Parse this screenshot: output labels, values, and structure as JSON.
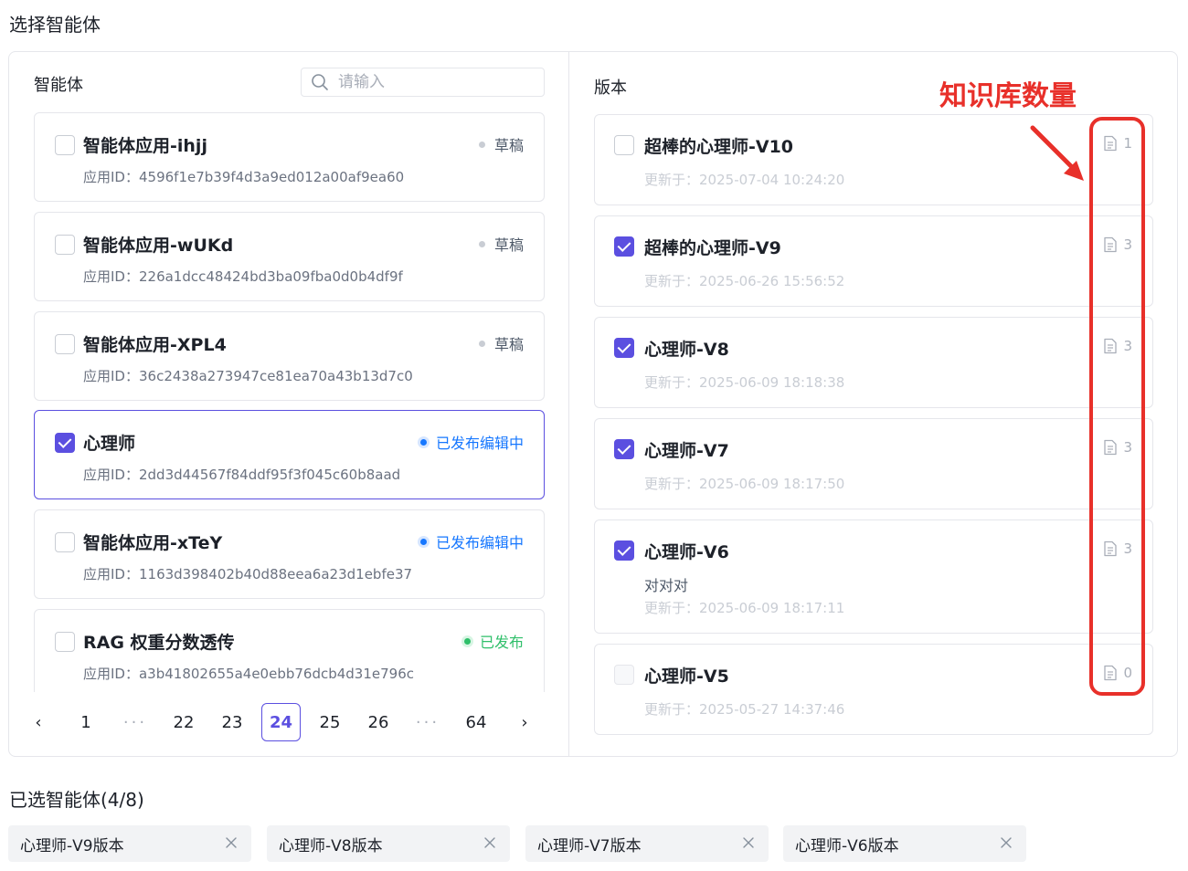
{
  "page_title": "选择智能体",
  "agents_panel": {
    "label": "智能体",
    "search_placeholder": "请输入",
    "agents": [
      {
        "name": "智能体应用-ihjj",
        "id_label": "应用ID：",
        "id": "4596f1e7b39f4d3a9ed012a00af9ea60",
        "status": "草稿",
        "status_type": "draft",
        "checked": false
      },
      {
        "name": "智能体应用-wUKd",
        "id_label": "应用ID：",
        "id": "226a1dcc48424bd3ba09fba0d0b4df9f",
        "status": "草稿",
        "status_type": "draft",
        "checked": false
      },
      {
        "name": "智能体应用-XPL4",
        "id_label": "应用ID：",
        "id": "36c2438a273947ce81ea70a43b13d7c0",
        "status": "草稿",
        "status_type": "draft",
        "checked": false
      },
      {
        "name": "心理师",
        "id_label": "应用ID：",
        "id": "2dd3d44567f84ddf95f3f045c60b8aad",
        "status": "已发布编辑中",
        "status_type": "editing",
        "checked": true
      },
      {
        "name": "智能体应用-xTeY",
        "id_label": "应用ID：",
        "id": "1163d398402b40d88eea6a23d1ebfe37",
        "status": "已发布编辑中",
        "status_type": "editing",
        "checked": false
      },
      {
        "name": "RAG 权重分数透传",
        "id_label": "应用ID：",
        "id": "a3b41802655a4e0ebb76dcb4d31e796c",
        "status": "已发布",
        "status_type": "published",
        "checked": false
      }
    ],
    "pagination": {
      "prev": "‹",
      "next": "›",
      "items": [
        "1",
        "···",
        "22",
        "23",
        "24",
        "25",
        "26",
        "···",
        "64"
      ],
      "current": "24"
    }
  },
  "versions_panel": {
    "label": "版本",
    "versions": [
      {
        "name": "超棒的心理师-V10",
        "note": "",
        "time_label": "更新于：",
        "time": "2025-07-04 10:24:20",
        "kb_count": "1",
        "state": "unchecked"
      },
      {
        "name": "超棒的心理师-V9",
        "note": "",
        "time_label": "更新于：",
        "time": "2025-06-26 15:56:52",
        "kb_count": "3",
        "state": "checked"
      },
      {
        "name": "心理师-V8",
        "note": "",
        "time_label": "更新于：",
        "time": "2025-06-09 18:18:38",
        "kb_count": "3",
        "state": "checked"
      },
      {
        "name": "心理师-V7",
        "note": "",
        "time_label": "更新于：",
        "time": "2025-06-09 18:17:50",
        "kb_count": "3",
        "state": "checked"
      },
      {
        "name": "心理师-V6",
        "note": "对对对",
        "time_label": "更新于：",
        "time": "2025-06-09 18:17:11",
        "kb_count": "3",
        "state": "checked"
      },
      {
        "name": "心理师-V5",
        "note": "",
        "time_label": "更新于：",
        "time": "2025-05-27 14:37:46",
        "kb_count": "0",
        "state": "disabled"
      }
    ]
  },
  "annotation": {
    "label": "知识库数量",
    "color": "#e8302a"
  },
  "selected": {
    "title": "已选智能体(4/8)",
    "tags": [
      "心理师-V9版本",
      "心理师-V8版本",
      "心理师-V7版本",
      "心理师-V6版本"
    ]
  },
  "colors": {
    "accent": "#5b4fe0",
    "editing": "#1677ff",
    "published": "#2fbf6a",
    "annotation": "#e8302a"
  },
  "icons": {
    "search": "search-icon",
    "doc": "document-icon",
    "close": "close-icon",
    "prev": "chevron-left-icon",
    "next": "chevron-right-icon"
  }
}
